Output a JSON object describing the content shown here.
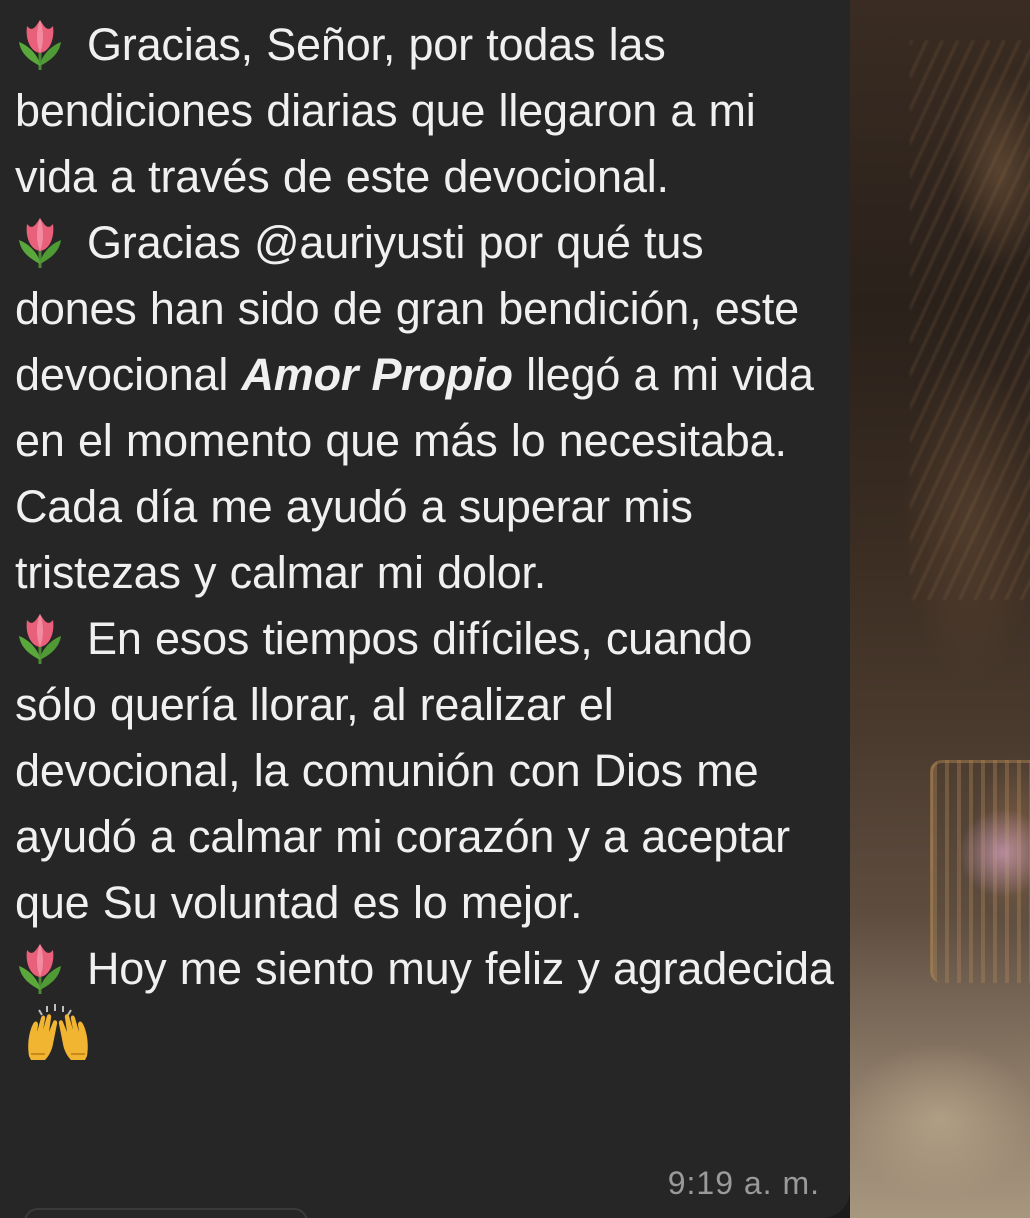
{
  "message": {
    "p1": "Gracias, Señor, por todas las bendiciones diarias que llegaron a mi vida a través de este devocional.",
    "p2_before": "Gracias @auriyusti por qué tus dones han sido de gran bendición, este devocional ",
    "p2_emphasis": "Amor Propio",
    "p2_after": " llegó a mi vida en el momento que más lo necesitaba. Cada día me ayudó a superar mis tristezas y calmar mi dolor.",
    "p3": "En esos tiempos difíciles, cuando sólo quería llorar, al realizar el devocional, la comunión con Dios me ayudó a calmar mi corazón y a aceptar que Su voluntad es lo mejor.",
    "p4": "Hoy me siento muy feliz y agradecida",
    "time": "9:19 a. m."
  },
  "icons": {
    "bullet": "tulip-icon",
    "closing": "raised-hands-icon"
  },
  "colors": {
    "bubble": "#262626",
    "text": "#f0f0f0",
    "timestamp": "#9a9a9a",
    "tulip": "#e8607a"
  }
}
